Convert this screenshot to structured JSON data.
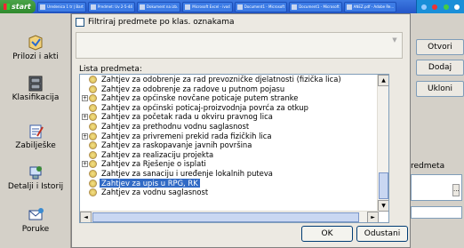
{
  "taskbar": {
    "start_label": "start",
    "tasks": [
      "Uredenica 1 tr | Bart",
      "Predmet: Uv 2-5-44",
      "Dokument na izb.",
      "Microsoft Excel - ivod",
      "Document1 - Microsoft",
      "Document1 - Microsoft",
      "ANEZ.pdf - Adobe Re..."
    ]
  },
  "left_nav": [
    {
      "label": "Prilozi i akti",
      "icon": "attachment-icon"
    },
    {
      "label": "Klasifikacija",
      "icon": "cabinet-icon"
    },
    {
      "label": "Zabilješke",
      "icon": "notes-icon"
    },
    {
      "label": "Detalji i Istorij",
      "icon": "details-icon"
    },
    {
      "label": "Poruke",
      "icon": "messages-icon"
    }
  ],
  "right_panel": {
    "buttons": [
      "Otvori",
      "Dodaj",
      "Ukloni"
    ],
    "label": "redmeta",
    "field_button": "..."
  },
  "dialog": {
    "filter_label": "Filtriraj predmete po klas. oznakama",
    "filter_checked": false,
    "list_label": "Lista predmeta:",
    "items": [
      {
        "text": "Zahtjev za odobrenje za rad prevozničke djelatnosti (fizička lica)",
        "expandable": false,
        "selected": false
      },
      {
        "text": "Zahtjev za odobrenje za radove u putnom pojasu",
        "expandable": false,
        "selected": false
      },
      {
        "text": "Zahtjev za općinske novčane poticaje putem stranke",
        "expandable": true,
        "selected": false
      },
      {
        "text": "Zahtjev za općinski poticaj-proizvodnja povrća za otkup",
        "expandable": false,
        "selected": false
      },
      {
        "text": "Zahtjev za početak rada u okviru pravnog lica",
        "expandable": true,
        "selected": false
      },
      {
        "text": "Zahtjev za prethodnu vodnu saglasnost",
        "expandable": false,
        "selected": false
      },
      {
        "text": "Zahtjev za privremeni prekid rada fizičkih lica",
        "expandable": true,
        "selected": false
      },
      {
        "text": "Zahtjev za raskopavanje javnih površina",
        "expandable": false,
        "selected": false
      },
      {
        "text": "Zahtjev za realizaciju projekta",
        "expandable": false,
        "selected": false
      },
      {
        "text": "Zahtjev za Rješenje o isplati",
        "expandable": true,
        "selected": false
      },
      {
        "text": "Zahtjev za sanaciju i uređenje lokalnih puteva",
        "expandable": false,
        "selected": false
      },
      {
        "text": "Zahtjev za upis u RPG, RK",
        "expandable": false,
        "selected": true
      },
      {
        "text": "Zahtjev za vodnu saglasnost",
        "expandable": false,
        "selected": false
      }
    ],
    "ok_label": "OK",
    "cancel_label": "Odustani"
  }
}
